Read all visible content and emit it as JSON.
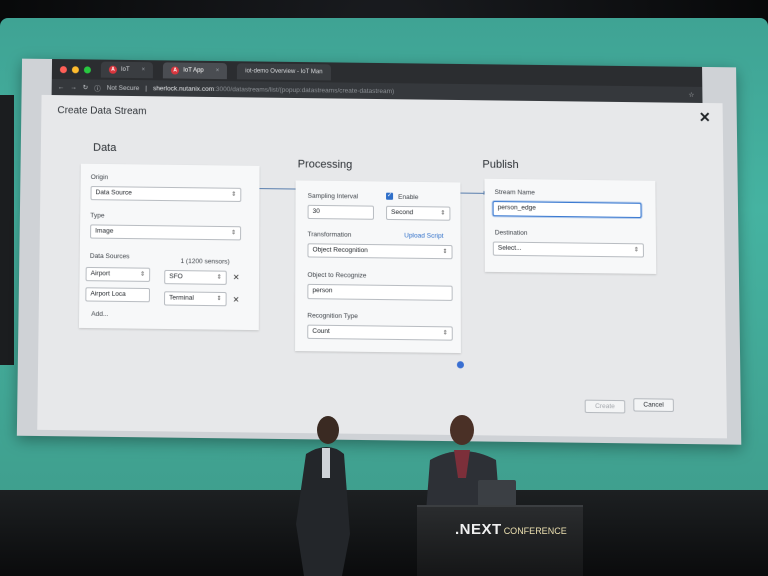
{
  "browser": {
    "tabs": [
      {
        "label": "IoT"
      },
      {
        "label": "IoT App"
      },
      {
        "label": "iot-demo Overview - IoT Man"
      }
    ],
    "security_label": "Not Secure",
    "url_host": "sherlock.nutanix.com",
    "url_path": ":3000/datastreams/list/(popup:datastreams/create-datastream)"
  },
  "dialog": {
    "title": "Create Data Stream",
    "data": {
      "heading": "Data",
      "origin_label": "Origin",
      "origin_value": "Data Source",
      "type_label": "Type",
      "type_value": "Image",
      "sources_label": "Data Sources",
      "sources_count": "1 (1200 sensors)",
      "rows": [
        {
          "key": "Airport",
          "value": "SFO"
        },
        {
          "key": "Airport Loca",
          "value": "Terminal"
        }
      ],
      "add_link": "Add..."
    },
    "processing": {
      "heading": "Processing",
      "sampling_label": "Sampling Interval",
      "sampling_value": "30",
      "enable_label": "Enable",
      "unit_value": "Second",
      "transformation_label": "Transformation",
      "upload_link": "Upload Script",
      "transformation_value": "Object Recognition",
      "object_label": "Object to Recognize",
      "object_value": "person",
      "recognition_label": "Recognition Type",
      "recognition_value": "Count"
    },
    "publish": {
      "heading": "Publish",
      "stream_label": "Stream Name",
      "stream_value": "person_edge",
      "destination_label": "Destination",
      "destination_placeholder": "Select..."
    },
    "create_button": "Create",
    "cancel_button": "Cancel"
  },
  "stage": {
    "brand": ".NEXT",
    "brand_suffix": "CONFERENCE"
  },
  "colors": {
    "screen_teal": "#45b3a1",
    "accent_blue": "#2f6fc9"
  }
}
